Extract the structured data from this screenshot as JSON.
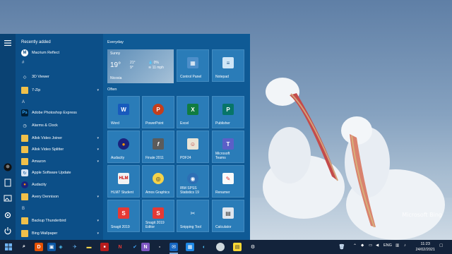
{
  "colors": {
    "start_bg": "#0a4d85",
    "tile_bg": "#2a7cb8",
    "taskbar_bg": "#13233b",
    "folder": "#f0c04a"
  },
  "desktop": {
    "watermark": "Microsoft Bing",
    "subject": "pelicans-wallpaper"
  },
  "rail": {
    "icons": [
      "hamburger-menu-icon",
      "user-avatar-icon",
      "documents-icon",
      "pictures-icon",
      "settings-icon",
      "power-icon"
    ]
  },
  "applist": {
    "recently_added_header": "Recently added",
    "items": [
      {
        "label": "Macrium Reflect",
        "icon": "macrium-icon"
      },
      {
        "letter": "#"
      },
      {
        "label": "3D Viewer",
        "icon": "3d-viewer-icon"
      },
      {
        "label": "7-Zip",
        "icon": "folder-icon",
        "folder": true
      },
      {
        "letter": "A"
      },
      {
        "label": "Adobe Photoshop Express",
        "icon": "photoshop-express-icon"
      },
      {
        "label": "Alarms & Clock",
        "icon": "alarm-clock-icon"
      },
      {
        "label": "Allok Video Joiner",
        "icon": "folder-icon",
        "folder": true
      },
      {
        "label": "Allok Video Splitter",
        "icon": "folder-icon",
        "folder": true
      },
      {
        "label": "Amazon",
        "icon": "folder-icon",
        "folder": true
      },
      {
        "label": "Apple Software Update",
        "icon": "apple-update-icon"
      },
      {
        "label": "Audacity",
        "icon": "audacity-icon"
      },
      {
        "label": "Avery Dennison",
        "icon": "folder-icon",
        "folder": true
      },
      {
        "letter": "B"
      },
      {
        "label": "Backup Thunderbird",
        "icon": "folder-icon",
        "folder": true
      },
      {
        "label": "Bing Wallpaper",
        "icon": "folder-icon",
        "folder": true
      }
    ]
  },
  "tiles": {
    "everyday_title": "Everyday",
    "often_title": "Often",
    "weather": {
      "condition": "Sunny",
      "temp": "19°",
      "high": "21°",
      "low": "9°",
      "rain": "0%",
      "wind": "11 mph",
      "location": "Nicosia"
    },
    "everyday": [
      {
        "label": "Control Panel",
        "icon": "control-panel-icon"
      },
      {
        "label": "Notepad",
        "icon": "notepad-icon"
      }
    ],
    "often": [
      {
        "label": "Word",
        "icon": "word-icon"
      },
      {
        "label": "PowerPoint",
        "icon": "powerpoint-icon"
      },
      {
        "label": "Excel",
        "icon": "excel-icon"
      },
      {
        "label": "Publisher",
        "icon": "publisher-icon"
      },
      {
        "label": "Audacity",
        "icon": "audacity-icon"
      },
      {
        "label": "Finale 2011",
        "icon": "finale-icon"
      },
      {
        "label": "PDF24",
        "icon": "pdf24-icon"
      },
      {
        "label": "Microsoft\nTeams",
        "icon": "teams-icon"
      },
      {
        "label": "HLM7 Student",
        "icon": "hlm7-icon"
      },
      {
        "label": "Amos Graphics",
        "icon": "amos-icon"
      },
      {
        "label": "IBM SPSS\nStatistics 19",
        "icon": "spss-icon"
      },
      {
        "label": "Renamer",
        "icon": "renamer-icon"
      },
      {
        "label": "Snagit 2019",
        "icon": "snagit-icon"
      },
      {
        "label": "Snagit 2019\nEditor",
        "icon": "snagit-editor-icon"
      },
      {
        "label": "Snipping Tool",
        "icon": "snipping-tool-icon"
      },
      {
        "label": "Calculator",
        "icon": "calculator-icon"
      }
    ]
  },
  "taskbar": {
    "language": "ENG",
    "time": "11:23",
    "date": "24/02/2021"
  }
}
